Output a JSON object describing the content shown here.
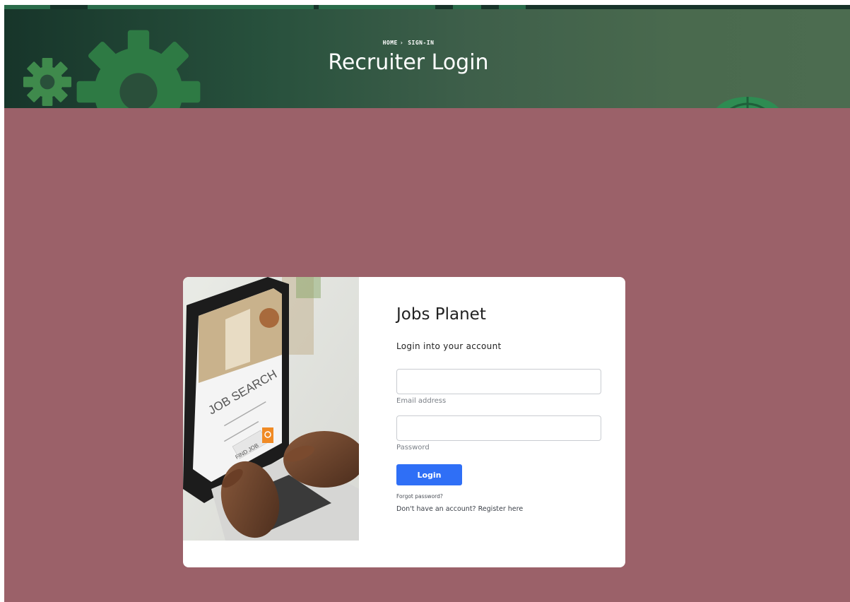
{
  "hero": {
    "breadcrumb_home": "HOME",
    "breadcrumb_separator": "›",
    "breadcrumb_current": "SIGN-IN",
    "title": "Recruiter Login"
  },
  "card": {
    "image_screen_text_primary": "JOB SEARCH",
    "image_screen_text_button": "FIND JOB"
  },
  "form": {
    "brand_title": "Jobs Planet",
    "subtitle": "Login into your account",
    "email_value": "",
    "email_label": "Email address",
    "password_value": "",
    "password_label": "Password",
    "login_label": "Login",
    "forgot_label": "Forgot password?",
    "register_prefix": "Don't have an account?",
    "register_link": "Register here"
  },
  "colors": {
    "page_background": "#9b6169",
    "hero_green": "#27503c",
    "accent_button": "#2f6ff6",
    "card_background": "#ffffff"
  },
  "icons": [
    "gear-icon",
    "search-icon"
  ]
}
